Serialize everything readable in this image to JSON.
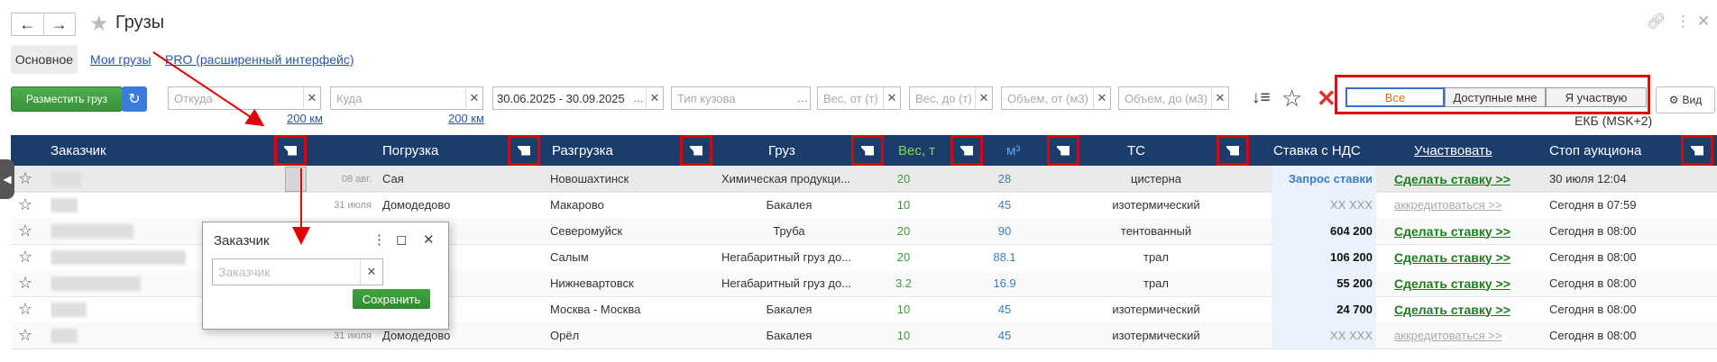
{
  "header": {
    "title": "Грузы"
  },
  "tabs": {
    "active": "Основное",
    "links": [
      "Мои грузы",
      "PRO (расширенный интерфейс)"
    ]
  },
  "toolbar": {
    "place_button": "Разместить груз",
    "from_placeholder": "Откуда",
    "to_placeholder": "Куда",
    "radius_from": "200 км",
    "radius_to": "200 км",
    "date_range": "30.06.2025 - 30.09.2025",
    "body_type_placeholder": "Тип кузова",
    "weight_from_placeholder": "Вес, от (т)",
    "weight_to_placeholder": "Вес, до (т)",
    "volume_from_placeholder": "Объем, от (м3)",
    "volume_to_placeholder": "Объем, до (м3)",
    "segments": [
      "Все",
      "Доступные мне",
      "Я участвую"
    ],
    "view_label": "Вид",
    "timezone": "ЕКБ (MSK+2)"
  },
  "table": {
    "columns": [
      "Заказчик",
      "Погрузка",
      "Разгрузка",
      "Груз",
      "Вес, т",
      "м³",
      "ТС",
      "Ставка с НДС",
      "Участвовать",
      "Стоп аукциона"
    ],
    "rows": [
      {
        "date": "08 авг.",
        "load": "Сая",
        "unload": "Новошахтинск",
        "cargo": "Химическая продукци...",
        "weight": "20",
        "volume": "28",
        "ts": "цистерна",
        "rate": "Запрос ставки",
        "action": "Сделать ставку >>",
        "stop": "30 июля 12:04"
      },
      {
        "date": "31 июля",
        "load": "Домодедово",
        "unload": "Макарово",
        "cargo": "Бакалея",
        "weight": "10",
        "volume": "45",
        "ts": "изотермический",
        "rate": "XX XXX",
        "action": "аккредитоваться >>",
        "stop": "Сегодня в 07:59"
      },
      {
        "date": "",
        "load": "",
        "unload": "Северомуйск",
        "cargo": "Труба",
        "weight": "20",
        "volume": "90",
        "ts": "тентованный",
        "rate": "604 200",
        "action": "Сделать ставку >>",
        "stop": "Сегодня в 08:00"
      },
      {
        "date": "",
        "load": "",
        "unload": "Салым",
        "cargo": "Негабаритный груз до...",
        "weight": "20",
        "volume": "88.1",
        "ts": "трал",
        "rate": "106 200",
        "action": "Сделать ставку >>",
        "stop": "Сегодня в 08:00"
      },
      {
        "date": "",
        "load": "",
        "unload": "Нижневартовск",
        "cargo": "Негабаритный груз до...",
        "weight": "3.2",
        "volume": "16.9",
        "ts": "трал",
        "rate": "55 200",
        "action": "Сделать ставку >>",
        "stop": "Сегодня в 08:00"
      },
      {
        "date": "",
        "load": "",
        "unload": "Москва - Москва",
        "cargo": "Бакалея",
        "weight": "10",
        "volume": "45",
        "ts": "изотермический",
        "rate": "24 700",
        "action": "Сделать ставку >>",
        "stop": "Сегодня в 08:00"
      },
      {
        "date": "31 июля",
        "load": "Домодедово",
        "unload": "Орёл",
        "cargo": "Бакалея",
        "weight": "10",
        "volume": "45",
        "ts": "изотермический",
        "rate": "XX XXX",
        "action": "аккредитоваться >>",
        "stop": "Сегодня в 08:00"
      }
    ]
  },
  "popup": {
    "title": "Заказчик",
    "placeholder": "Заказчик",
    "save_label": "Сохранить"
  },
  "colors": {
    "header_bg": "#1b3d6b",
    "highlight": "#e00000",
    "accent_green": "#3e9a3e",
    "accent_blue": "#3c7cc4"
  }
}
